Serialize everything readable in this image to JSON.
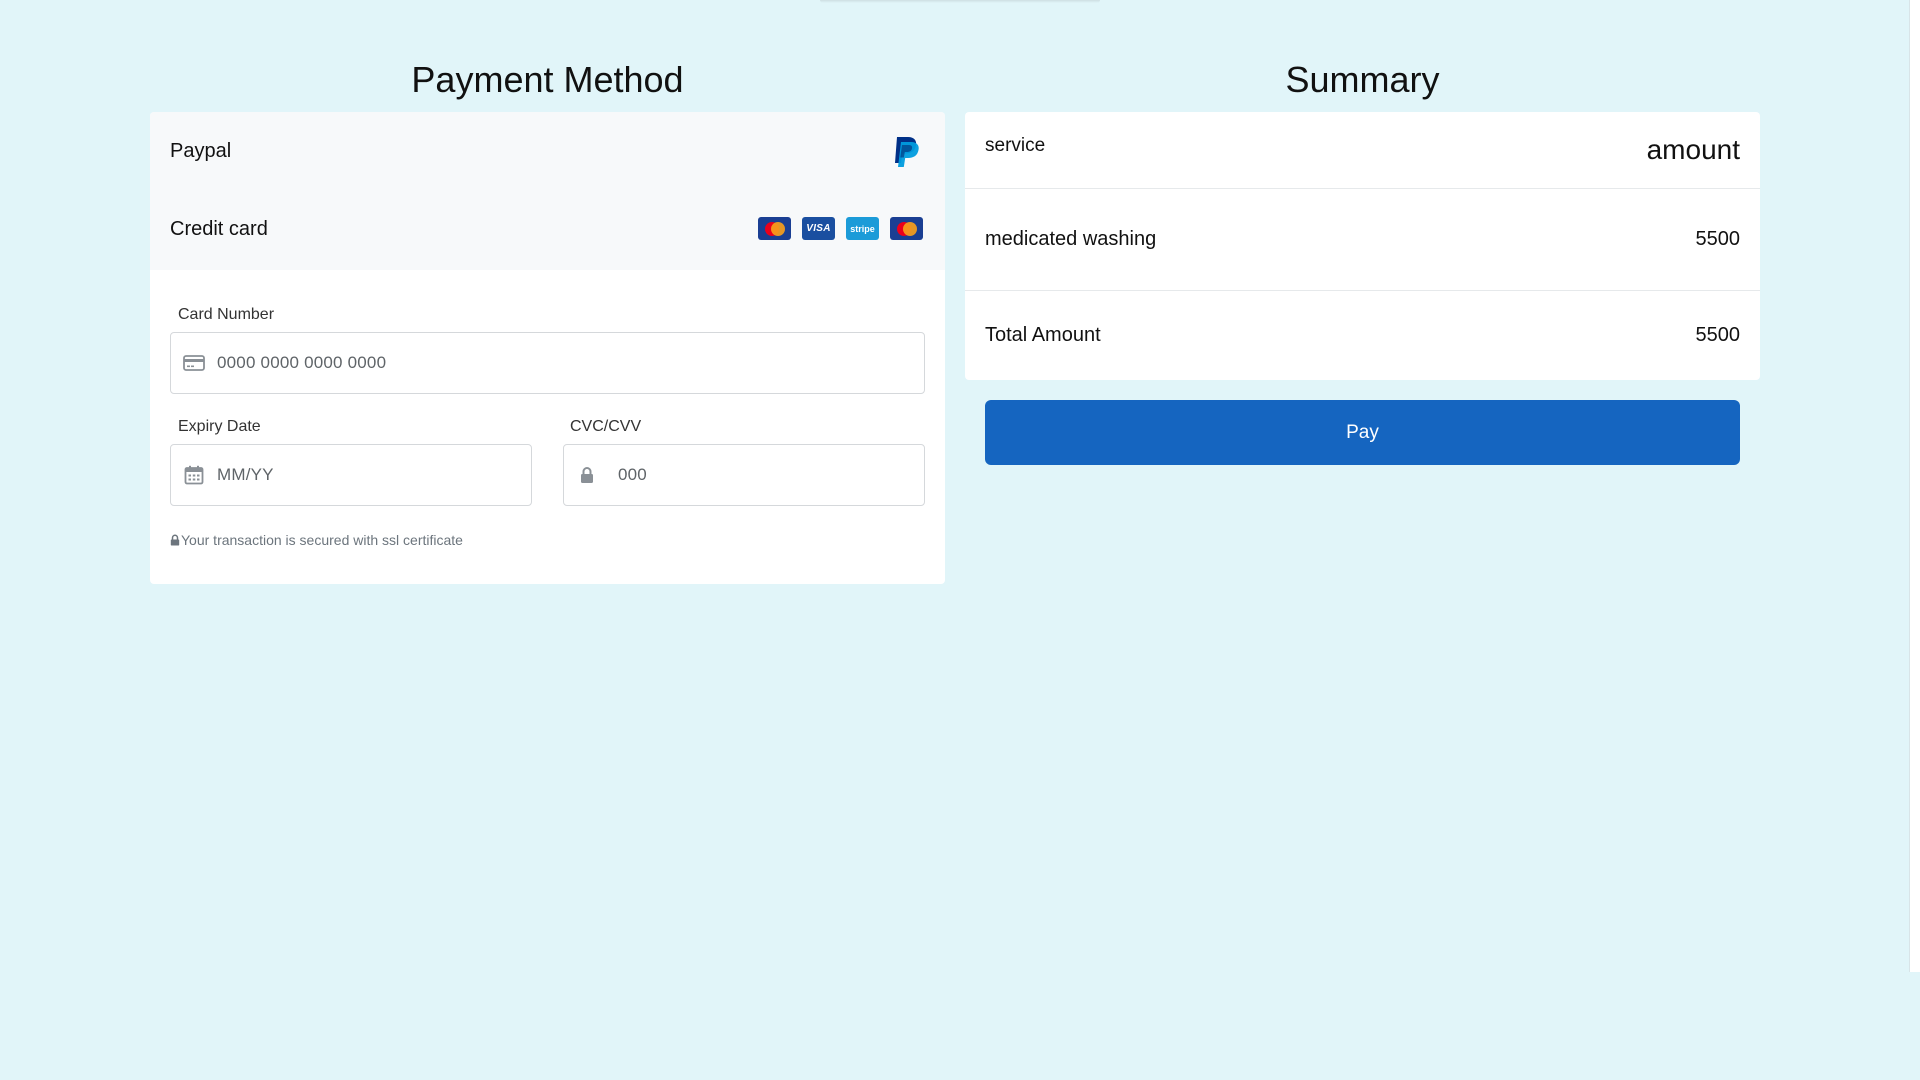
{
  "payment": {
    "title": "Payment Method",
    "methods": [
      {
        "label": "Paypal",
        "icon": "paypal-icon"
      },
      {
        "label": "Credit card",
        "icons": [
          "mastercard-icon",
          "visa-icon",
          "stripe-icon",
          "mastercard-icon"
        ]
      }
    ],
    "logos": {
      "visa": "VISA",
      "stripe": "stripe"
    },
    "card_number": {
      "label": "Card Number",
      "placeholder": "0000 0000 0000 0000",
      "icon": "credit-card-icon"
    },
    "expiry": {
      "label": "Expiry Date",
      "placeholder": "MM/YY",
      "icon": "calendar-icon"
    },
    "cvc": {
      "label": "CVC/CVV",
      "placeholder": "000",
      "icon": "lock-icon"
    },
    "ssl_note": "Your transaction is secured with ssl certificate"
  },
  "summary": {
    "title": "Summary",
    "header": {
      "service": "service",
      "amount": "amount"
    },
    "items": [
      {
        "service": "medicated washing",
        "amount": "5500"
      }
    ],
    "total": {
      "label": "Total Amount",
      "amount": "5500"
    }
  },
  "pay_button": {
    "label": "Pay"
  },
  "colors": {
    "background": "#e1f5f9",
    "accent": "#1565c0",
    "method_panel": "#f7f9fa"
  }
}
